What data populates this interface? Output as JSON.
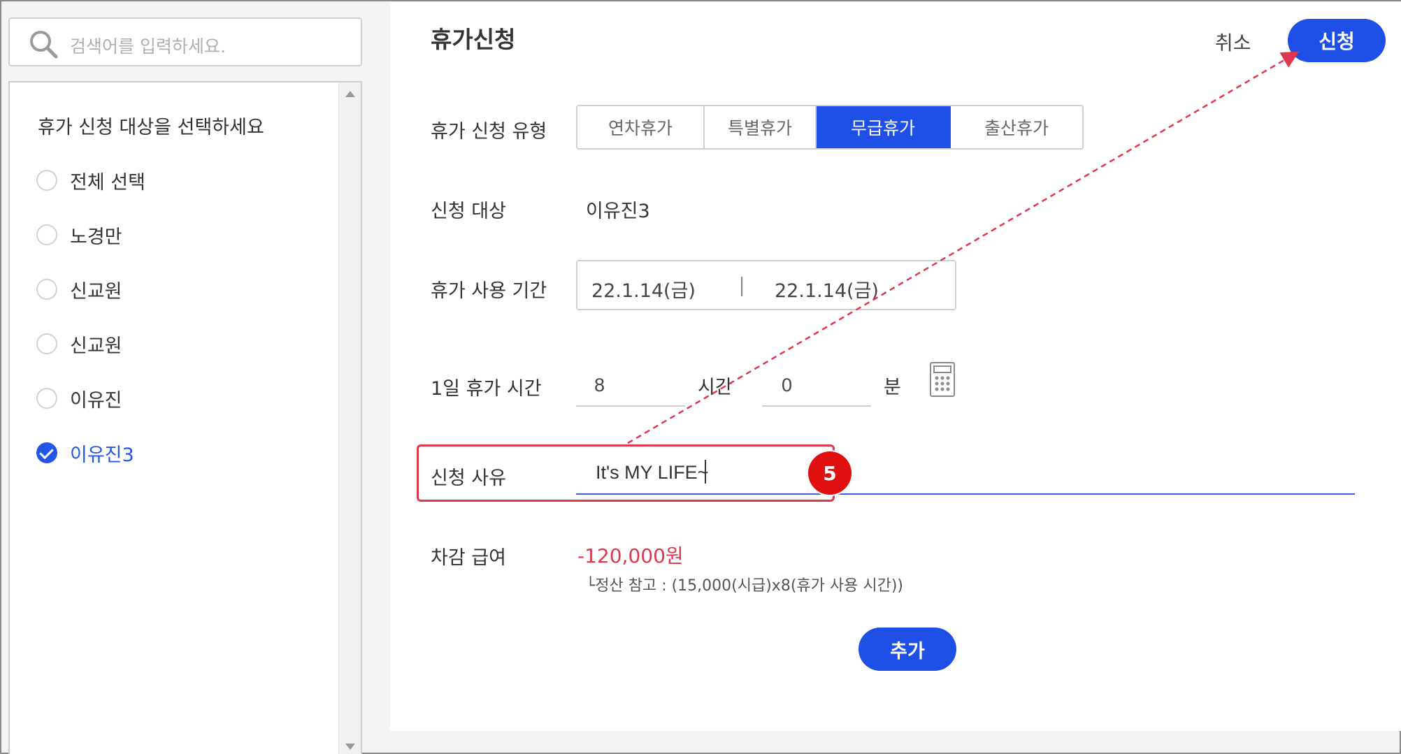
{
  "search": {
    "placeholder": "검색어를 입력하세요."
  },
  "sidebar": {
    "title": "휴가 신청 대상을 선택하세요",
    "items": [
      {
        "label": "전체 선택",
        "checked": false
      },
      {
        "label": "노경만",
        "checked": false
      },
      {
        "label": "신교원",
        "checked": false
      },
      {
        "label": "신교원",
        "checked": false
      },
      {
        "label": "이유진",
        "checked": false
      },
      {
        "label": "이유진3",
        "checked": true
      }
    ]
  },
  "header": {
    "title": "휴가신청",
    "cancel_label": "취소",
    "submit_label": "신청"
  },
  "form": {
    "type_label": "휴가 신청 유형",
    "types": [
      "연차휴가",
      "특별휴가",
      "무급휴가",
      "출산휴가"
    ],
    "active_type": "무급휴가",
    "target_label": "신청 대상",
    "target_value": "이유진3",
    "period_label": "휴가 사용 기간",
    "period_start": "22.1.14(금)",
    "period_end": "22.1.14(금)",
    "daily_label": "1일 휴가 시간",
    "hours_value": "8",
    "hours_unit": "시간",
    "minutes_value": "0",
    "minutes_unit": "분",
    "reason_label": "신청 사유",
    "reason_value": "It's MY LIFE~",
    "deduction_label": "차감 급여",
    "deduction_amount": "-120,000원",
    "deduction_note": "└정산 참고 : (15,000(시급)x8(휴가 사용 시간))",
    "add_label": "추가"
  },
  "annotation": {
    "step": "5",
    "highlight_color": "#e0374f"
  },
  "colors": {
    "primary": "#1e4fe6",
    "danger": "#e0374f",
    "badge": "#e01010"
  }
}
